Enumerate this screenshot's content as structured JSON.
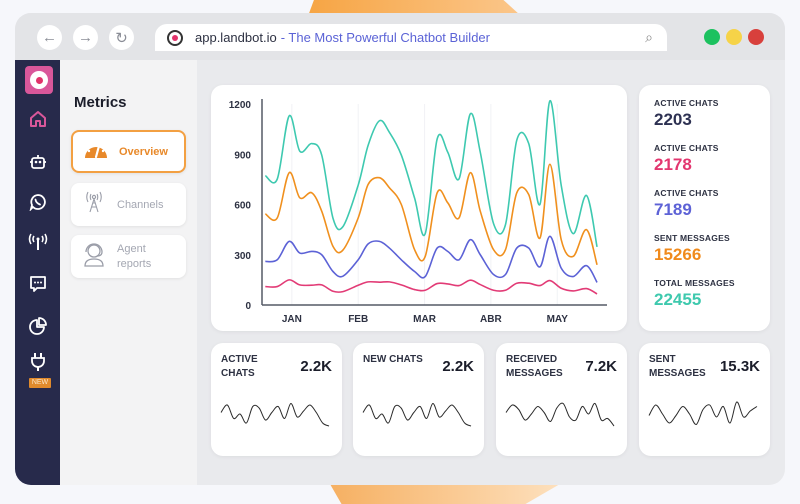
{
  "browser": {
    "nav": {
      "back": "←",
      "forward": "→",
      "reload": "↻"
    },
    "url_host": "app.landbot.io",
    "url_title": "- The Most Powerful Chatbot Builder",
    "search_icon": "⌕",
    "window_dots": [
      "#1cc15f",
      "#f6d348",
      "#d8403c"
    ]
  },
  "sidebar": {
    "items": [
      {
        "name": "home",
        "glyph": "⌂",
        "active": true
      },
      {
        "name": "bot",
        "glyph": "🤖"
      },
      {
        "name": "whatsapp",
        "glyph": "✆"
      },
      {
        "name": "broadcast",
        "glyph": "📶"
      },
      {
        "name": "chat",
        "glyph": "💬"
      },
      {
        "name": "analytics",
        "glyph": "◔"
      },
      {
        "name": "integrations",
        "glyph": "⏚"
      }
    ],
    "new_badge": "NEW"
  },
  "metrics": {
    "title": "Metrics",
    "menu": [
      {
        "label": "Overview",
        "icon": "gauge-icon",
        "glyph": "◠",
        "active": true
      },
      {
        "label": "Channels",
        "icon": "antenna-icon",
        "glyph": "📡"
      },
      {
        "label": "Agent reports",
        "icon": "headset-icon",
        "glyph": "🎧"
      }
    ]
  },
  "stats": [
    {
      "label": "ACTIVE CHATS",
      "value": "2203",
      "color": "#2d3152"
    },
    {
      "label": "ACTIVE CHATS",
      "value": "2178",
      "color": "#e3366f"
    },
    {
      "label": "ACTIVE CHATS",
      "value": "7189",
      "color": "#5d62d6"
    },
    {
      "label": "SENT MESSAGES",
      "value": "15266",
      "color": "#f08a1c"
    },
    {
      "label": "TOTAL MESSAGES",
      "value": "22455",
      "color": "#3ec9ae"
    }
  ],
  "mini_cards": [
    {
      "label": "ACTIVE CHATS",
      "value": "2.2K"
    },
    {
      "label": "NEW CHATS",
      "value": "2.2K"
    },
    {
      "label": "RECEIVED MESSAGES",
      "value": "7.2K"
    },
    {
      "label": "SENT MESSAGES",
      "value": "15.3K"
    }
  ],
  "chart_data": {
    "type": "line",
    "title": "",
    "xlabel": "",
    "ylabel": "",
    "ylim": [
      0,
      1200
    ],
    "yticks": [
      0,
      300,
      600,
      900,
      1200
    ],
    "month_labels": [
      "JAN",
      "FEB",
      "MAR",
      "ABR",
      "MAY"
    ],
    "x_range_months": [
      -0.45,
      4.75
    ],
    "grid": "vertical-light",
    "legend": "none",
    "x": [
      -0.4,
      -0.22,
      -0.04,
      0.12,
      0.3,
      0.45,
      0.62,
      0.77,
      1.0,
      1.15,
      1.32,
      1.47,
      1.65,
      1.85,
      2.01,
      2.19,
      2.35,
      2.52,
      2.69,
      2.84,
      3.04,
      3.22,
      3.39,
      3.57,
      3.74,
      3.89,
      4.06,
      4.24,
      4.44,
      4.6
    ],
    "series": [
      {
        "name": "teal",
        "color": "#3ec9b0",
        "values": [
          772,
          752,
          1129,
          918,
          964,
          895,
          518,
          468,
          716,
          954,
          1100,
          1031,
          895,
          638,
          426,
          991,
          912,
          753,
          1141,
          912,
          486,
          480,
          984,
          964,
          601,
          1219,
          714,
          426,
          654,
          347
        ]
      },
      {
        "name": "orange",
        "color": "#f0901e",
        "values": [
          544,
          520,
          790,
          640,
          670,
          560,
          350,
          328,
          520,
          720,
          760,
          700,
          600,
          330,
          290,
          670,
          610,
          520,
          790,
          560,
          330,
          330,
          670,
          660,
          400,
          840,
          390,
          290,
          450,
          240
        ]
      },
      {
        "name": "blue",
        "color": "#5c62d6",
        "values": [
          260,
          270,
          380,
          310,
          320,
          300,
          200,
          172,
          270,
          365,
          380,
          340,
          270,
          200,
          170,
          340,
          320,
          270,
          390,
          300,
          182,
          182,
          340,
          340,
          228,
          410,
          220,
          170,
          235,
          135
        ]
      },
      {
        "name": "pink",
        "color": "#e23b76",
        "values": [
          110,
          110,
          150,
          120,
          118,
          120,
          82,
          80,
          118,
          138,
          136,
          138,
          120,
          92,
          88,
          128,
          126,
          116,
          148,
          122,
          88,
          88,
          130,
          130,
          116,
          146,
          100,
          84,
          98,
          66
        ]
      }
    ]
  },
  "sparklines": [
    [
      0.55,
      0.8,
      0.35,
      0.5,
      0.2,
      0.75,
      0.7,
      0.3,
      0.55,
      0.75,
      0.35,
      0.85,
      0.4,
      0.6,
      0.8,
      0.55,
      0.2,
      0.1
    ],
    [
      0.55,
      0.8,
      0.35,
      0.5,
      0.2,
      0.75,
      0.7,
      0.3,
      0.55,
      0.75,
      0.35,
      0.85,
      0.4,
      0.6,
      0.8,
      0.55,
      0.2,
      0.1
    ],
    [
      0.55,
      0.8,
      0.65,
      0.3,
      0.5,
      0.75,
      0.55,
      0.25,
      0.7,
      0.85,
      0.4,
      0.3,
      0.75,
      0.5,
      0.85,
      0.3,
      0.35,
      0.1
    ],
    [
      0.45,
      0.8,
      0.5,
      0.2,
      0.45,
      0.75,
      0.5,
      0.15,
      0.65,
      0.8,
      0.4,
      0.75,
      0.2,
      0.9,
      0.4,
      0.6,
      0.75
    ]
  ]
}
